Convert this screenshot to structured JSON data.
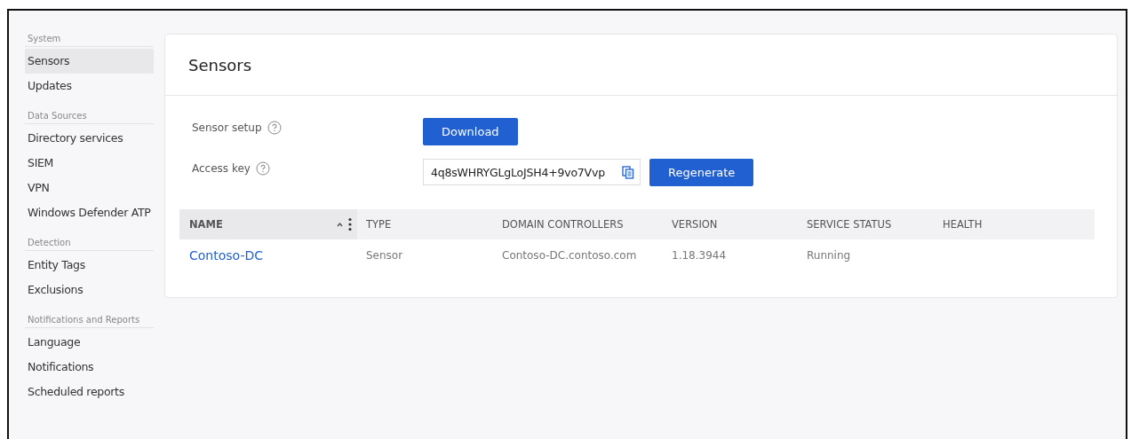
{
  "sidebar": {
    "sections": [
      {
        "title": "System",
        "items": [
          {
            "label": "Sensors",
            "selected": true
          },
          {
            "label": "Updates",
            "selected": false
          }
        ]
      },
      {
        "title": "Data Sources",
        "items": [
          {
            "label": "Directory services",
            "selected": false
          },
          {
            "label": "SIEM",
            "selected": false
          },
          {
            "label": "VPN",
            "selected": false
          },
          {
            "label": "Windows Defender ATP",
            "selected": false
          }
        ]
      },
      {
        "title": "Detection",
        "items": [
          {
            "label": "Entity Tags",
            "selected": false
          },
          {
            "label": "Exclusions",
            "selected": false
          }
        ]
      },
      {
        "title": "Notifications and Reports",
        "items": [
          {
            "label": "Language",
            "selected": false
          },
          {
            "label": "Notifications",
            "selected": false
          },
          {
            "label": "Scheduled reports",
            "selected": false
          }
        ]
      }
    ]
  },
  "page_title": "Sensors",
  "sensor_setup": {
    "label": "Sensor setup",
    "button": "Download"
  },
  "access_key": {
    "label": "Access key",
    "value": "4q8sWHRYGLgLoJSH4+9vo7Vvp",
    "button": "Regenerate"
  },
  "table": {
    "columns": [
      "NAME",
      "TYPE",
      "DOMAIN CONTROLLERS",
      "VERSION",
      "SERVICE STATUS",
      "HEALTH"
    ],
    "rows": [
      {
        "cells": [
          "Contoso-DC",
          "Sensor",
          "Contoso-DC.contoso.com",
          "1.18.3944",
          "Running",
          ""
        ]
      }
    ]
  }
}
